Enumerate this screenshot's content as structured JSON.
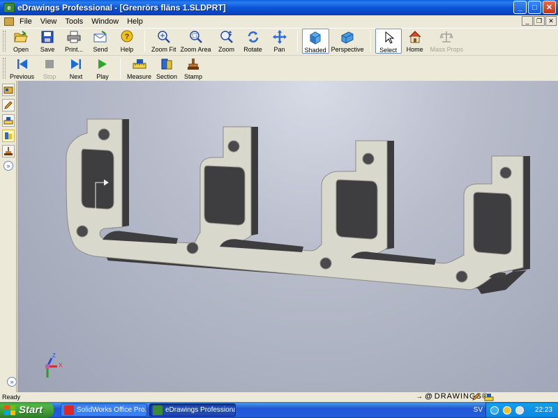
{
  "window": {
    "app_icon_text": "e",
    "title": "eDrawings Professional - [Grenrörs fläns 1.SLDPRT]",
    "controls": {
      "minimize": "_",
      "maximize": "□",
      "close": "✕"
    }
  },
  "menu": {
    "items": [
      "File",
      "View",
      "Tools",
      "Window",
      "Help"
    ],
    "mdi_controls": {
      "minimize": "_",
      "restore": "❐",
      "close": "✕"
    }
  },
  "toolbar1": {
    "buttons": [
      {
        "id": "open",
        "label": "Open",
        "icon": "folder-open-icon"
      },
      {
        "id": "save",
        "label": "Save",
        "icon": "floppy-icon"
      },
      {
        "id": "print",
        "label": "Print...",
        "icon": "printer-icon"
      },
      {
        "id": "send",
        "label": "Send",
        "icon": "envelope-icon"
      },
      {
        "id": "help",
        "label": "Help",
        "icon": "help-icon"
      },
      {
        "id": "zoom-fit",
        "label": "Zoom Fit",
        "icon": "zoom-fit-icon"
      },
      {
        "id": "zoom-area",
        "label": "Zoom Area",
        "icon": "zoom-area-icon"
      },
      {
        "id": "zoom",
        "label": "Zoom",
        "icon": "zoom-icon"
      },
      {
        "id": "rotate",
        "label": "Rotate",
        "icon": "rotate-icon"
      },
      {
        "id": "pan",
        "label": "Pan",
        "icon": "pan-icon"
      },
      {
        "id": "shaded",
        "label": "Shaded",
        "icon": "shaded-cube-icon",
        "pressed": true
      },
      {
        "id": "perspective",
        "label": "Perspective",
        "icon": "perspective-icon"
      },
      {
        "id": "select",
        "label": "Select",
        "icon": "pointer-icon",
        "pressed": true
      },
      {
        "id": "home",
        "label": "Home",
        "icon": "home-icon"
      },
      {
        "id": "mass-props",
        "label": "Mass Props",
        "icon": "scale-icon",
        "disabled": true
      }
    ]
  },
  "toolbar2": {
    "buttons": [
      {
        "id": "previous",
        "label": "Previous",
        "icon": "skip-previous-icon"
      },
      {
        "id": "stop",
        "label": "Stop",
        "icon": "stop-icon",
        "disabled": true
      },
      {
        "id": "next",
        "label": "Next",
        "icon": "skip-next-icon"
      },
      {
        "id": "play",
        "label": "Play",
        "icon": "play-icon"
      },
      {
        "id": "measure",
        "label": "Measure",
        "icon": "measure-icon"
      },
      {
        "id": "section",
        "label": "Section",
        "icon": "section-icon"
      },
      {
        "id": "stamp",
        "label": "Stamp",
        "icon": "stamp-icon"
      }
    ]
  },
  "sidepanel": {
    "buttons": [
      "component-icon",
      "markup-pencil-icon",
      "measure-icon",
      "section-icon",
      "stamp-icon"
    ],
    "expand": "»"
  },
  "viewport": {
    "model": "flange-part",
    "triad": {
      "x_label": "X",
      "z_label": "Z"
    }
  },
  "status": {
    "text": "Ready",
    "brand_arrow": "→",
    "brand_at": "@",
    "brand": "DRAWINGS®"
  },
  "taskbar": {
    "start_label": "Start",
    "tasks": [
      {
        "label": "SolidWorks Office Pro...",
        "active": false
      },
      {
        "label": "eDrawings Professiona...",
        "active": true
      }
    ],
    "language": "SV",
    "clock": "22:23"
  },
  "colors": {
    "titlebar": "#0a5fdd",
    "viewport_bg": "#b8bccb",
    "part_face": "#d9d8cc",
    "part_side": "#3b3b3d"
  }
}
